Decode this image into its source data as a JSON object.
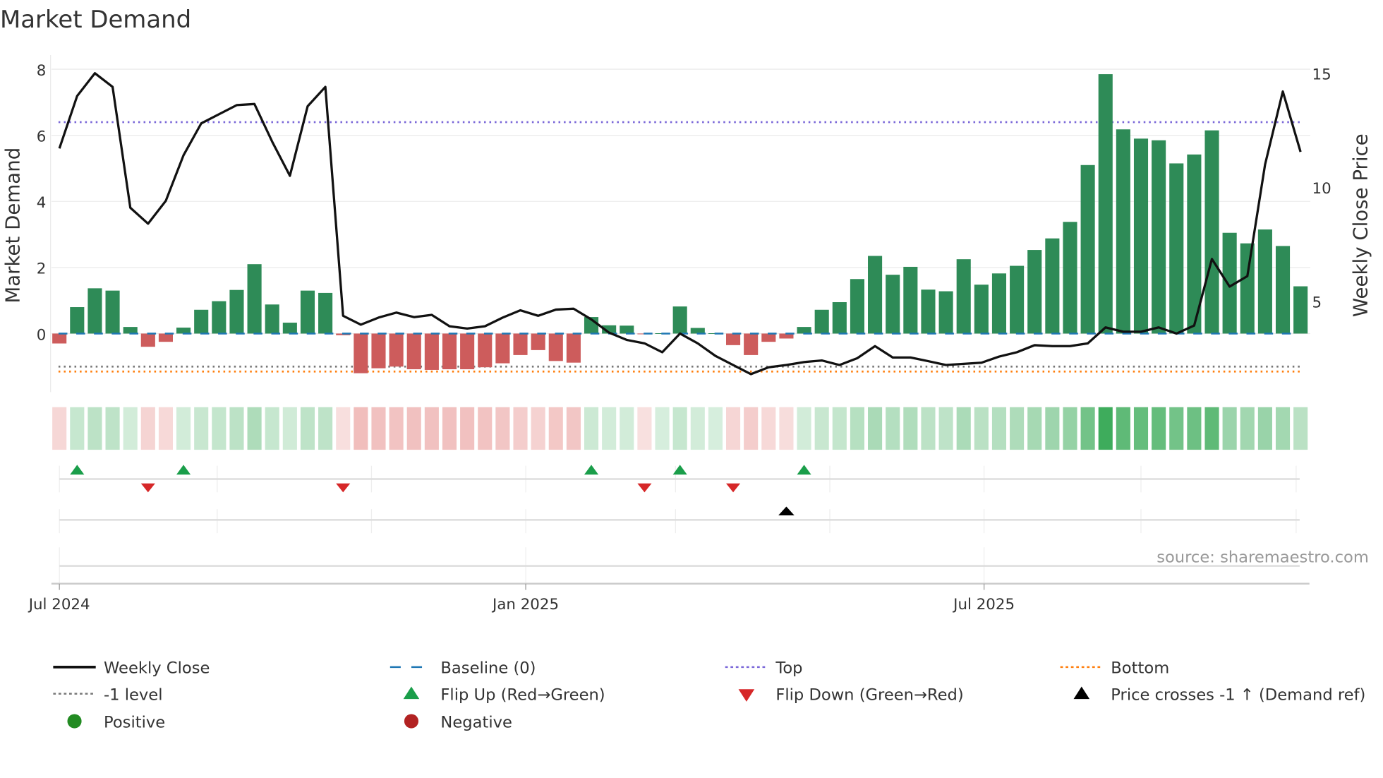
{
  "chart_data": {
    "type": "bar",
    "title": "Market Demand",
    "ylabel": "Market Demand",
    "y2label": "Weekly Close Price",
    "ylim": [
      -1.7,
      8.1
    ],
    "y2lim": [
      0,
      15.2
    ],
    "yticks": [
      "0",
      "2",
      "4",
      "6",
      "8"
    ],
    "y2ticks": [
      "5",
      "10",
      "15"
    ],
    "xticks": [
      "Jul 2024",
      "Jan 2025",
      "Jul 2025"
    ],
    "source": "source: sharemaestro.com",
    "levels": {
      "top": 6.4,
      "minus_one": -1.0,
      "bottom": -1.15,
      "baseline": 0
    },
    "demand": [
      -0.3,
      0.8,
      1.37,
      1.3,
      0.2,
      -0.4,
      -0.25,
      0.18,
      0.72,
      0.98,
      1.32,
      2.1,
      0.88,
      0.33,
      1.3,
      1.23,
      -0.05,
      -1.2,
      -1.05,
      -1.0,
      -1.08,
      -1.1,
      -1.08,
      -1.08,
      -1.02,
      -0.9,
      -0.65,
      -0.5,
      -0.83,
      -0.88,
      0.5,
      0.25,
      0.24,
      -0.02,
      0.01,
      0.82,
      0.17,
      0.01,
      -0.35,
      -0.65,
      -0.25,
      -0.15,
      0.2,
      0.72,
      0.95,
      1.65,
      2.35,
      1.78,
      2.02,
      1.33,
      1.28,
      2.25,
      1.48,
      1.82,
      2.05,
      2.53,
      2.88,
      3.38,
      5.1,
      7.85,
      6.18,
      5.9,
      5.85,
      5.15,
      5.42,
      6.15,
      3.05,
      2.73,
      3.15,
      2.65,
      1.43
    ],
    "price": [
      11.7,
      14.0,
      15.0,
      14.4,
      9.1,
      8.4,
      9.4,
      11.4,
      12.8,
      13.2,
      13.6,
      13.65,
      12.0,
      10.5,
      13.55,
      14.4,
      4.36,
      3.97,
      4.28,
      4.5,
      4.3,
      4.4,
      3.9,
      3.8,
      3.9,
      4.28,
      4.6,
      4.36,
      4.63,
      4.67,
      4.2,
      3.62,
      3.3,
      3.15,
      2.76,
      3.58,
      3.15,
      2.6,
      2.2,
      1.8,
      2.1,
      2.2,
      2.33,
      2.4,
      2.2,
      2.5,
      3.03,
      2.53,
      2.53,
      2.37,
      2.2,
      2.25,
      2.3,
      2.57,
      2.76,
      3.07,
      3.03,
      3.03,
      3.15,
      3.85,
      3.66,
      3.66,
      3.85,
      3.58,
      3.93,
      6.85,
      5.64,
      6.1,
      11.0,
      14.2,
      11.55
    ],
    "flip_up_weeks": [
      1,
      7,
      30,
      35,
      42
    ],
    "flip_down_weeks": [
      5,
      16,
      33,
      38
    ],
    "price_cross_weeks": [
      41
    ],
    "legend": [
      "Weekly Close",
      "Baseline (0)",
      "Top",
      "Bottom",
      "-1 level",
      "Flip Up (Red→Green)",
      "Flip Down (Green→Red)",
      "Price crosses -1 ↑ (Demand ref)",
      "Positive",
      "Negative"
    ],
    "colors": {
      "positive_bar": "#2e8b57",
      "negative_bar": "#cd5c5c",
      "price": "#111111",
      "baseline": "#1f77b4",
      "top": "#7b68d9",
      "bottom": "#ff7f0e",
      "minus_one": "#777777",
      "flip_up": "#1a9e4a",
      "flip_down": "#d62728",
      "positive_dot": "#228b22",
      "negative_dot": "#b22222"
    }
  }
}
